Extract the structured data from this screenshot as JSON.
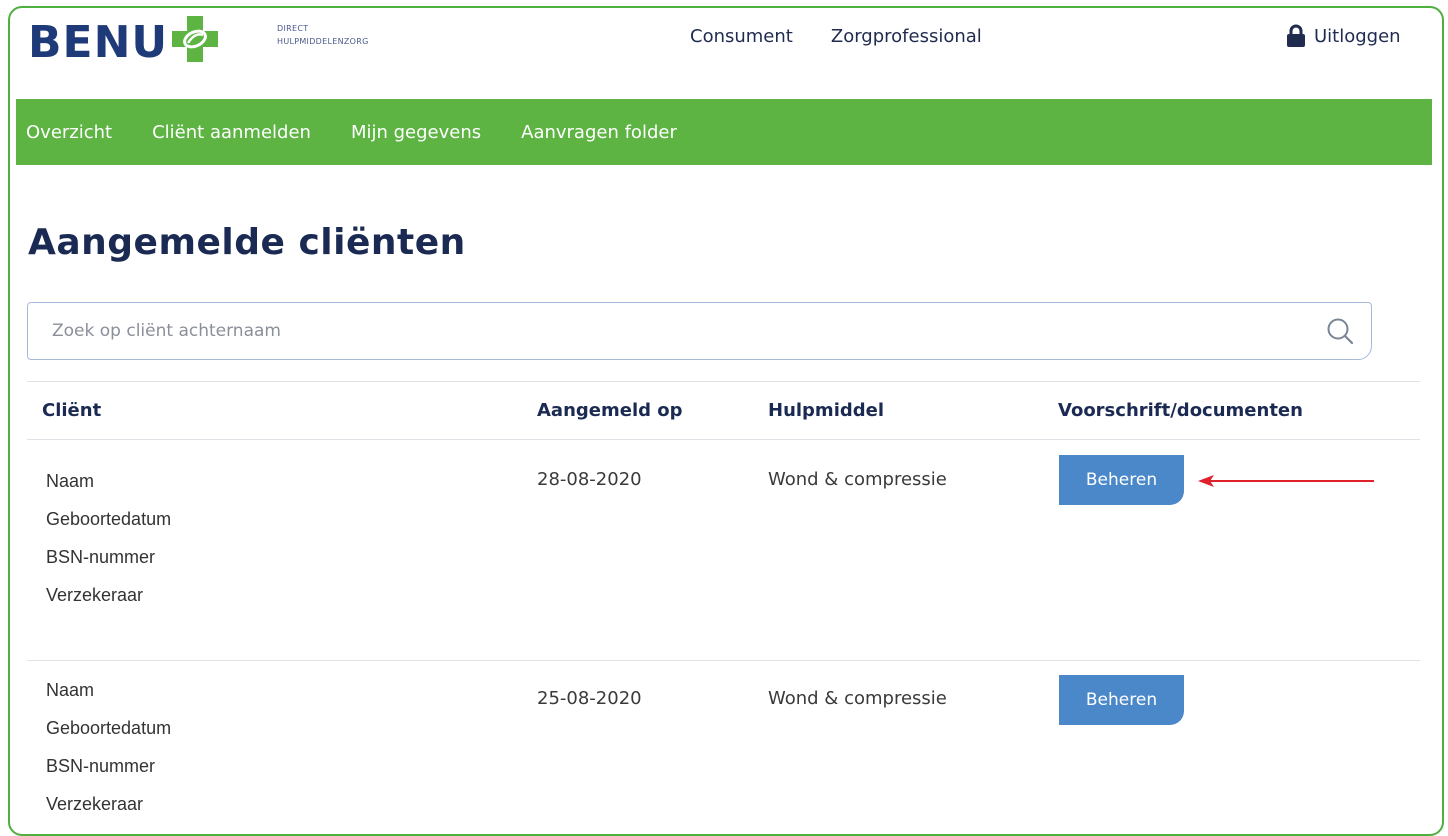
{
  "header": {
    "logo_text": "BENU",
    "tagline_line1": "DIRECT",
    "tagline_line2": "HULPMIDDELENZORG",
    "top_links": [
      "Consument",
      "Zorgprofessional"
    ],
    "logout_label": "Uitloggen",
    "brand_green": "#5db443",
    "brand_navy": "#1e3a78"
  },
  "nav": {
    "items": [
      "Overzicht",
      "Cliënt aanmelden",
      "Mijn gegevens",
      "Aanvragen folder"
    ]
  },
  "page": {
    "title": "Aangemelde cliënten"
  },
  "search": {
    "placeholder": "Zoek op cliënt achternaam",
    "value": ""
  },
  "table": {
    "headers": [
      "Cliënt",
      "Aangemeld op",
      "Hulpmiddel",
      "Voorschrift/documenten"
    ],
    "rows": [
      {
        "client": [
          "Naam",
          "Geboortedatum",
          "BSN-nummer",
          "Verzekeraar"
        ],
        "date": "28-08-2020",
        "aid": "Wond & compressie",
        "action": "Beheren"
      },
      {
        "client": [
          "Naam",
          "Geboortedatum",
          "BSN-nummer",
          "Verzekeraar"
        ],
        "date": "25-08-2020",
        "aid": "Wond & compressie",
        "action": "Beheren"
      }
    ]
  },
  "annotation": {
    "arrow_color": "#e0202a"
  }
}
